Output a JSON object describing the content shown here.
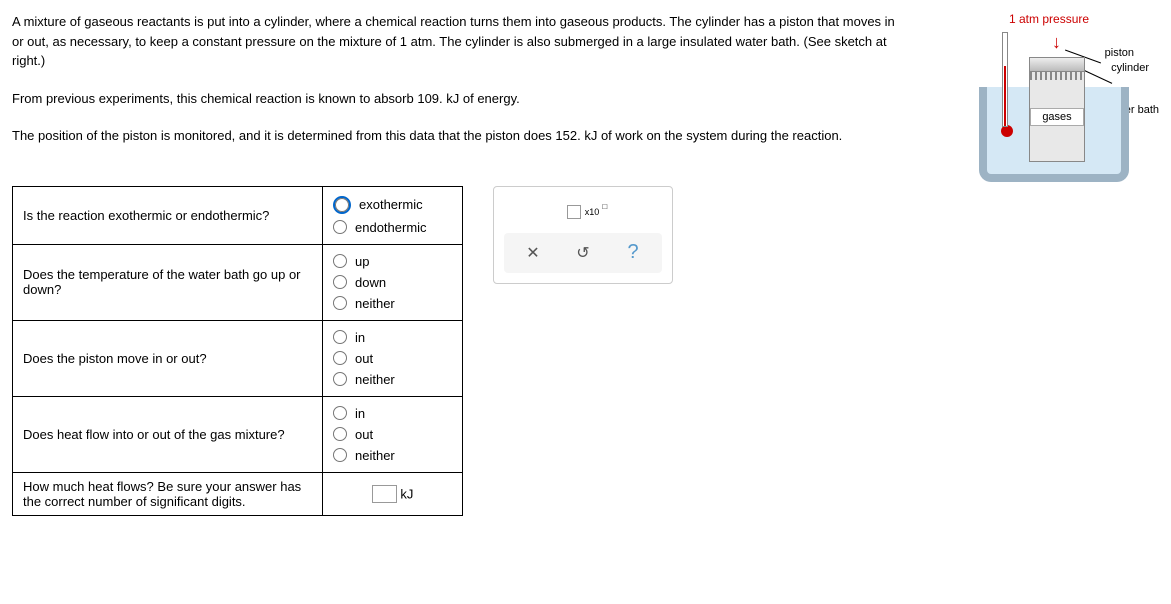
{
  "paragraphs": {
    "p1": "A mixture of gaseous reactants is put into a cylinder, where a chemical reaction turns them into gaseous products. The cylinder has a piston that moves in or out, as necessary, to keep a constant pressure on the mixture of 1 atm. The cylinder is also submerged in a large insulated water bath. (See sketch at right.)",
    "p2": "From previous experiments, this chemical reaction is known to absorb 109. kJ of energy.",
    "p3": "The position of the piston is monitored, and it is determined from this data that the piston does 152. kJ of work on the system during the reaction."
  },
  "questions": {
    "q1": {
      "text": "Is the reaction exothermic or endothermic?",
      "options": {
        "a": "exothermic",
        "b": "endothermic"
      }
    },
    "q2": {
      "text": "Does the temperature of the water bath go up or down?",
      "options": {
        "a": "up",
        "b": "down",
        "c": "neither"
      }
    },
    "q3": {
      "text": "Does the piston move in or out?",
      "options": {
        "a": "in",
        "b": "out",
        "c": "neither"
      }
    },
    "q4": {
      "text": "Does heat flow into or out of the gas mixture?",
      "options": {
        "a": "in",
        "b": "out",
        "c": "neither"
      }
    },
    "q5": {
      "text": "How much heat flows? Be sure your answer has the correct number of significant digits.",
      "unit": "kJ"
    }
  },
  "toolbox": {
    "sci_base": "x10",
    "sci_sup": "□",
    "close": "✕",
    "reset": "↺",
    "help": "?"
  },
  "diagram": {
    "pressure": "1 atm pressure",
    "arrow": "↓",
    "piston": "piston",
    "cylinder": "cylinder",
    "waterbath": "water bath",
    "gases": "gases"
  }
}
